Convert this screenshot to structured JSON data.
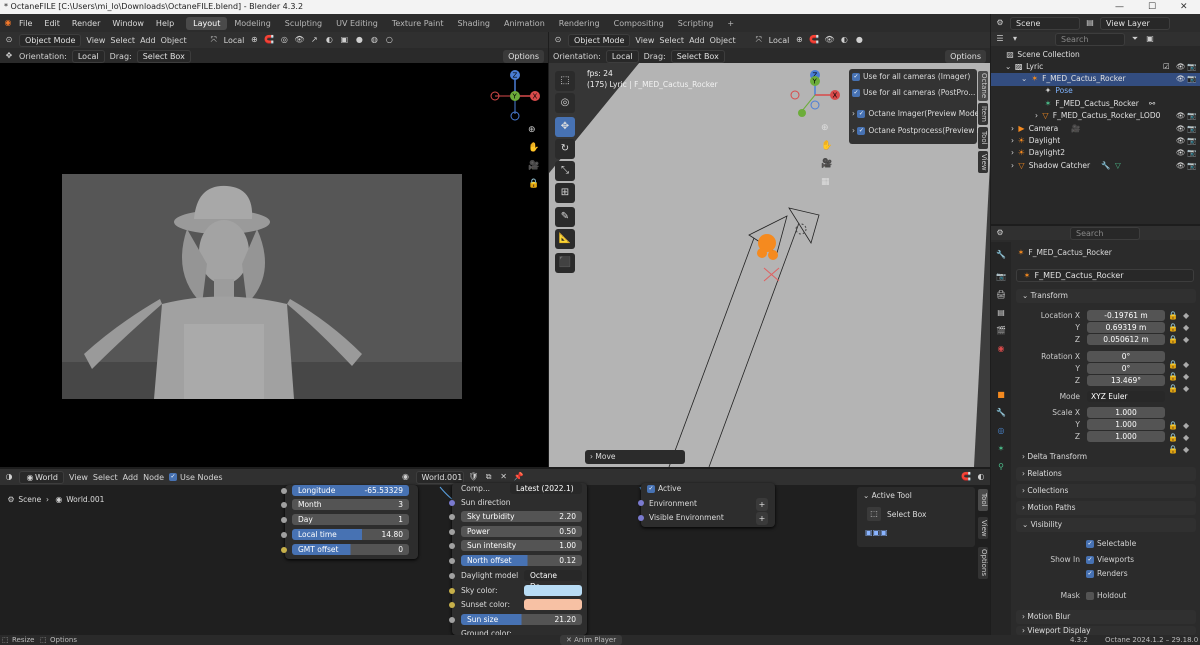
{
  "window": {
    "title": "* OctaneFILE [C:\\Users\\mi_lo\\Downloads\\OctaneFILE.blend] - Blender 4.3.2"
  },
  "menu": {
    "items": [
      "File",
      "Edit",
      "Render",
      "Window",
      "Help"
    ]
  },
  "workspaces": [
    "Layout",
    "Modeling",
    "Sculpting",
    "UV Editing",
    "Texture Paint",
    "Shading",
    "Animation",
    "Rendering",
    "Compositing",
    "Scripting"
  ],
  "scene": {
    "name": "Scene",
    "view_layer": "View Layer"
  },
  "viewport_left": {
    "mode": "Object Mode",
    "menus": [
      "View",
      "Select",
      "Add",
      "Object"
    ],
    "orientation_label": "Orientation:",
    "orientation": "Local",
    "transform": "Local",
    "drag_label": "Drag:",
    "drag": "Select Box",
    "options": "Options"
  },
  "viewport_right": {
    "mode": "Object Mode",
    "menus": [
      "View",
      "Select",
      "Add",
      "Object"
    ],
    "orientation_label": "Orientation:",
    "orientation": "Local",
    "transform": "Local",
    "drag_label": "Drag:",
    "drag": "Select Box",
    "options": "Options",
    "fps": "fps: 24",
    "info": "(175) Lyric | F_MED_Cactus_Rocker",
    "octane_panel": {
      "use_all_imager": "Use for all cameras (Imager)",
      "use_all_post": "Use for all cameras (PostPro...",
      "imager": "Octane Imager(Preview Mode)",
      "postprocess": "Octane Postprocess(Preview M"
    },
    "move_panel": "Move",
    "side_tabs": [
      "Octane",
      "Item",
      "Tool",
      "View"
    ]
  },
  "outliner": {
    "search_placeholder": "Search",
    "rows": [
      {
        "label": "Scene Collection"
      },
      {
        "label": "Lyric"
      },
      {
        "label": "F_MED_Cactus_Rocker"
      },
      {
        "label": "Pose"
      },
      {
        "label": "F_MED_Cactus_Rocker"
      },
      {
        "label": "F_MED_Cactus_Rocker_LOD0"
      },
      {
        "label": "Camera"
      },
      {
        "label": "Daylight"
      },
      {
        "label": "Daylight2"
      },
      {
        "label": "Shadow Catcher"
      }
    ]
  },
  "properties": {
    "search_placeholder": "Search",
    "object_name": "F_MED_Cactus_Rocker",
    "object_field": "F_MED_Cactus_Rocker",
    "transform_header": "Transform",
    "location": {
      "label_x": "Location X",
      "x": "-0.19761 m",
      "y": "0.69319 m",
      "z": "0.050612 m"
    },
    "rotation": {
      "label_x": "Rotation X",
      "x": "0°",
      "y": "0°",
      "z": "13.469°"
    },
    "mode_label": "Mode",
    "mode": "XYZ Euler",
    "scale": {
      "label_x": "Scale X",
      "x": "1.000",
      "y": "1.000",
      "z": "1.000"
    },
    "axis_y": "Y",
    "axis_z": "Z",
    "sections": [
      "Delta Transform",
      "Relations",
      "Collections",
      "Motion Paths",
      "Visibility",
      "Motion Blur",
      "Viewport Display"
    ],
    "visibility": {
      "selectable": "Selectable",
      "show_in": "Show In",
      "viewports": "Viewports",
      "renders": "Renders",
      "mask": "Mask",
      "holdout": "Holdout"
    }
  },
  "node_editor": {
    "type": "World",
    "menus": [
      "View",
      "Select",
      "Add",
      "Node"
    ],
    "use_nodes": "Use Nodes",
    "world_name": "World.001",
    "breadcrumb": [
      "Scene",
      "World.001"
    ],
    "node_left": [
      {
        "label": "Longitude",
        "value": "-65.53329"
      },
      {
        "label": "Month",
        "value": "3"
      },
      {
        "label": "Day",
        "value": "1"
      },
      {
        "label": "Local time",
        "value": "14.80"
      },
      {
        "label": "GMT offset",
        "value": "0"
      }
    ],
    "daylight": {
      "comp_label": "Comp...",
      "comp_value": "Latest (2022.1)",
      "sun_direction": "Sun direction",
      "fields": [
        {
          "label": "Sky turbidity",
          "value": "2.20"
        },
        {
          "label": "Power",
          "value": "0.50"
        },
        {
          "label": "Sun intensity",
          "value": "1.00"
        },
        {
          "label": "North offset",
          "value": "0.12"
        }
      ],
      "model_label": "Daylight model",
      "model_value": "Octane Da...",
      "sky_color": "Sky color:",
      "sunset_color": "Sunset color:",
      "sun_size_label": "Sun size",
      "sun_size": "21.20",
      "ground_color": "Ground color:",
      "sky_hex": "#b8dcf5",
      "sunset_hex": "#f7c1a4"
    },
    "output_node": {
      "active": "Active",
      "environment": "Environment",
      "visible_env": "Visible Environment"
    },
    "tool_panel": {
      "title": "Active Tool",
      "tool": "Select Box"
    },
    "side_tabs": [
      "Tool",
      "View",
      "Options"
    ]
  },
  "status": {
    "resize": "Resize",
    "options": "Options",
    "anim_player": "Anim Player",
    "version": "4.3.2",
    "octane": "Octane 2024.1.2 – 29.18.0"
  }
}
